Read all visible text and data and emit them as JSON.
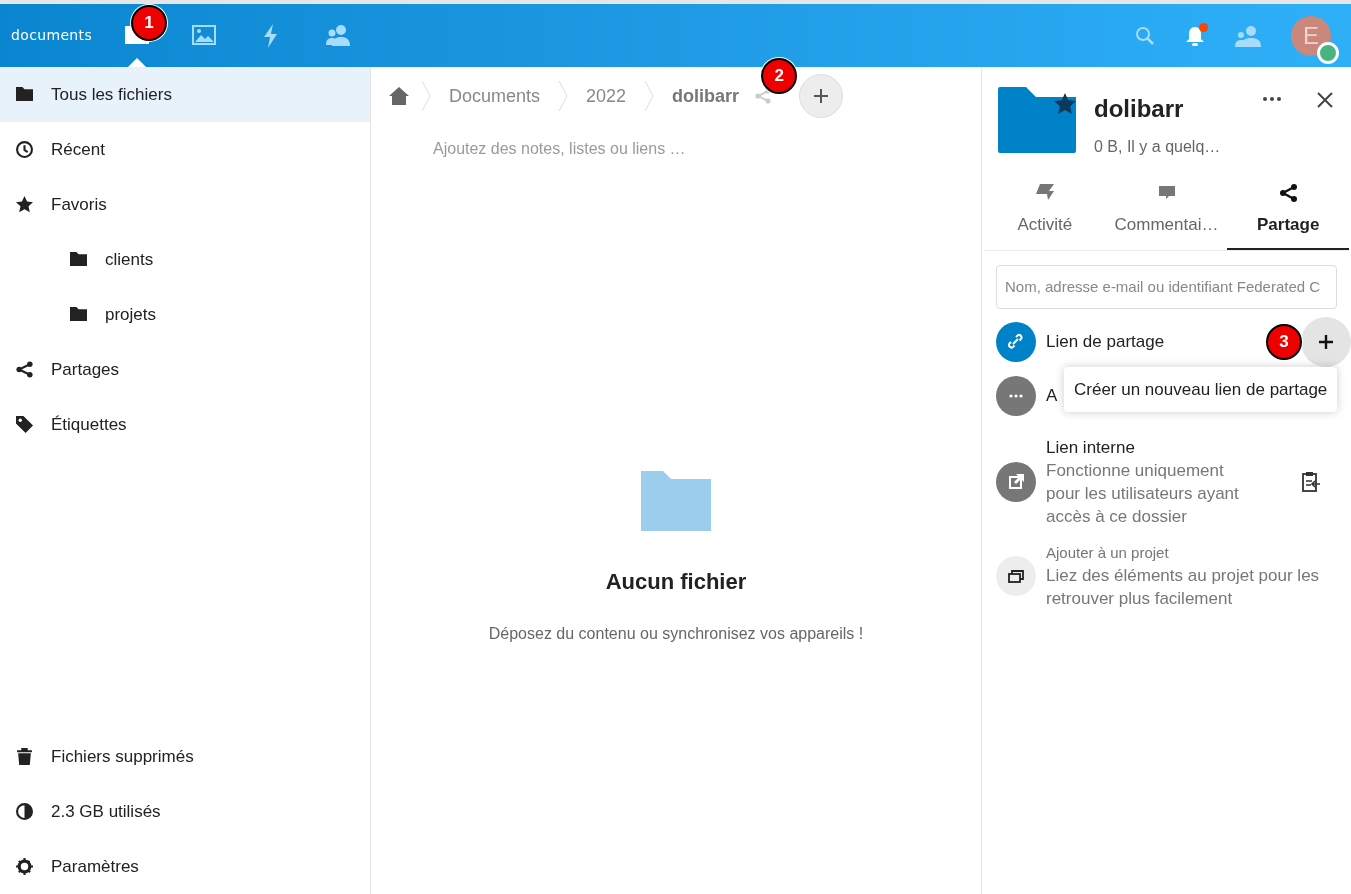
{
  "header": {
    "logo": "documents",
    "apps": [
      {
        "kind": "files",
        "selected": true
      },
      {
        "kind": "photos",
        "selected": false
      },
      {
        "kind": "activity",
        "selected": false
      },
      {
        "kind": "contacts",
        "selected": false
      }
    ],
    "notification_unread": true,
    "avatar": {
      "initial": "E",
      "online": true
    }
  },
  "sidebar": {
    "items": [
      {
        "kind": "folder",
        "label": "Tous les fichiers",
        "selected": true
      },
      {
        "kind": "clock",
        "label": "Récent",
        "selected": false
      },
      {
        "kind": "star",
        "label": "Favoris",
        "selected": false,
        "children": [
          {
            "kind": "folder",
            "label": "clients",
            "selected": false
          },
          {
            "kind": "folder",
            "label": "projets",
            "selected": false
          }
        ]
      },
      {
        "kind": "share",
        "label": "Partages",
        "selected": false
      },
      {
        "kind": "tag",
        "label": "Étiquettes",
        "selected": false
      }
    ],
    "footer": [
      {
        "kind": "trash",
        "label": "Fichiers supprimés"
      },
      {
        "kind": "pie",
        "label": "2.3 GB utilisés"
      },
      {
        "kind": "gear",
        "label": "Paramètres"
      }
    ]
  },
  "breadcrumbs": [
    "Documents",
    "2022",
    "dolibarr"
  ],
  "notes_placeholder": "Ajoutez des notes, listes ou liens …",
  "empty": {
    "title": "Aucun fichier",
    "text": "Déposez du contenu ou synchronisez vos appareils !"
  },
  "details": {
    "name": "dolibarr",
    "meta": "0 B, Il y a quelq…",
    "favorite": true,
    "tabs": [
      {
        "kind": "activity",
        "label": "Activité",
        "selected": false
      },
      {
        "kind": "comments",
        "label": "Commentai…",
        "selected": false
      },
      {
        "kind": "share",
        "label": "Partage",
        "selected": true
      }
    ],
    "search": {
      "placeholder": "Nom, adresse e-mail ou identifiant Federated C"
    },
    "rows": [
      {
        "kind": "link",
        "title": "Lien de partage"
      },
      {
        "kind": "more",
        "title": "A"
      },
      {
        "kind": "internal",
        "title": "Lien interne",
        "text": "Fonctionne uniquement pour les utilisateurs ayant accès à ce dossier"
      },
      {
        "kind": "project",
        "title": "Ajouter à un projet",
        "text": "Liez des éléments au projet pour les retrouver plus facilement"
      }
    ],
    "tooltip": "Créer un nouveau lien de partage"
  },
  "callouts": [
    "1",
    "2",
    "3"
  ]
}
